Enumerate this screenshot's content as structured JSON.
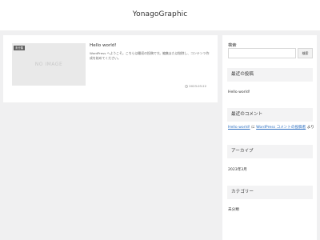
{
  "header": {
    "site_title": "YonagoGraphic"
  },
  "post": {
    "thumbnail_text": "NO IMAGE",
    "category": "未分類",
    "title": "Hello world!",
    "excerpt": "WordPress へようこそ。こちらは最初の投稿です。編集または削除し、コンテンツ作成を始めてください。",
    "date": "2023.03.22"
  },
  "sidebar": {
    "search": {
      "label": "検索",
      "placeholder": "",
      "button_label": "検索"
    },
    "recent_posts": {
      "title": "最近の投稿",
      "items": [
        "Hello world!"
      ]
    },
    "recent_comments": {
      "title": "最近のコメント",
      "author": "Hello world!",
      "connector": " に ",
      "commenter": "WordPress コメントの投稿者",
      "suffix": " より"
    },
    "archives": {
      "title": "アーカイブ",
      "items": [
        "2023年3月"
      ]
    },
    "categories": {
      "title": "カテゴリー",
      "items": [
        "未分類"
      ]
    }
  }
}
